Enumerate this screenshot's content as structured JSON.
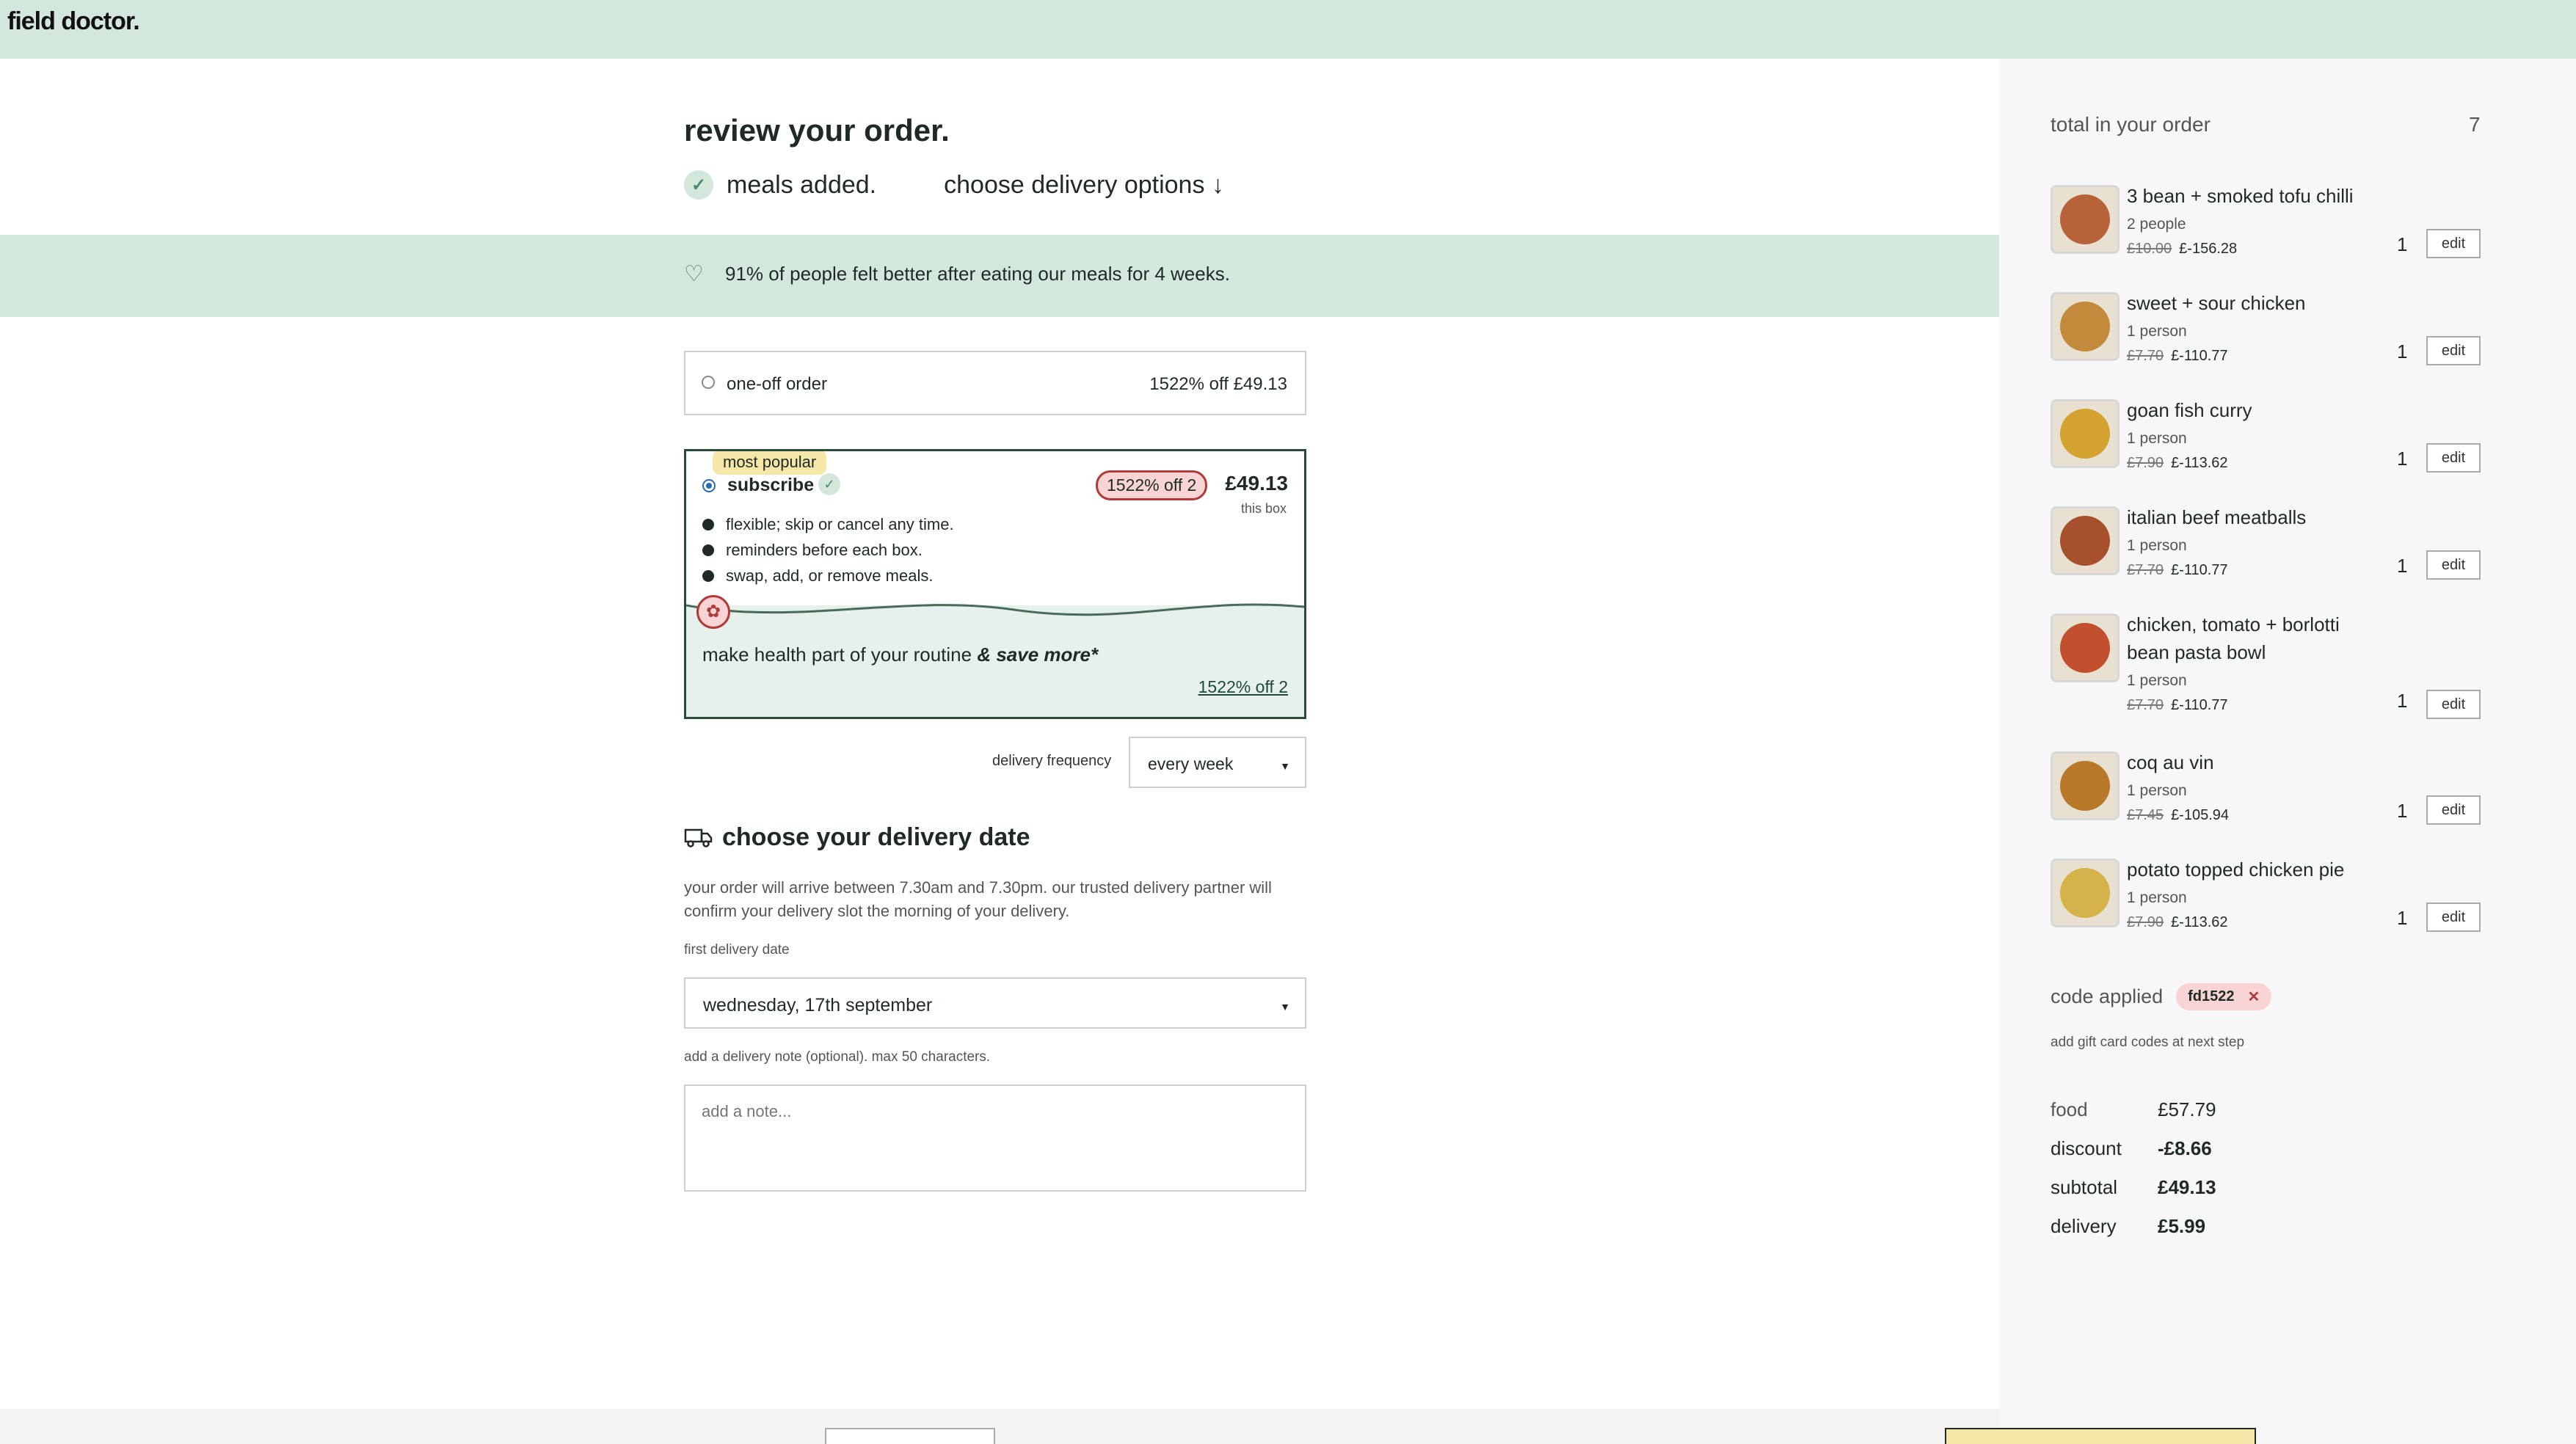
{
  "header": {
    "logo": "field doctor."
  },
  "main": {
    "title": "review your order.",
    "steps": [
      {
        "label": "meals added."
      },
      {
        "label": "choose delivery options ↓"
      }
    ],
    "promo": "91% of people felt better after eating our meals for 4 weeks.",
    "oneoff": {
      "label": "one-off order",
      "price": "1522% off  £49.13"
    },
    "subscribe": {
      "tag": "most popular",
      "label": "subscribe",
      "badge": "1522% off 2",
      "price": "£49.13",
      "note": "this box",
      "bullets": [
        "flexible; skip or cancel any time.",
        "reminders before each box.",
        "swap, add, or remove meals."
      ],
      "routine": "make health part of your routine ",
      "routine_em": "& save more*",
      "link": "1522% off 2"
    },
    "frequency": {
      "label": "delivery frequency",
      "value": "every week"
    },
    "delivery": {
      "title": "choose your delivery date",
      "desc": "your order will arrive between 7.30am and 7.30pm. our trusted delivery partner will confirm your delivery slot the morning of your delivery.",
      "first_date_label": "first delivery date",
      "date_value": "wednesday, 17th september",
      "note_label": "add a delivery note (optional). max 50 characters.",
      "note_placeholder": "add a note..."
    }
  },
  "summary": {
    "title": "total in your order",
    "count": "7",
    "items": [
      {
        "name": "3 bean + smoked tofu chilli",
        "serves": "2 people",
        "old": "£10.00",
        "new": "£-156.28",
        "qty": "1",
        "edit": "edit"
      },
      {
        "name": "sweet + sour chicken",
        "serves": "1 person",
        "old": "£7.70",
        "new": "£-110.77",
        "qty": "1",
        "edit": "edit"
      },
      {
        "name": "goan fish curry",
        "serves": "1 person",
        "old": "£7.90",
        "new": "£-113.62",
        "qty": "1",
        "edit": "edit"
      },
      {
        "name": "italian beef meatballs",
        "serves": "1 person",
        "old": "£7.70",
        "new": "£-110.77",
        "qty": "1",
        "edit": "edit"
      },
      {
        "name": "chicken, tomato + borlotti bean pasta bowl",
        "serves": "1 person",
        "old": "£7.70",
        "new": "£-110.77",
        "qty": "1",
        "edit": "edit"
      },
      {
        "name": "coq au vin",
        "serves": "1 person",
        "old": "£7.45",
        "new": "£-105.94",
        "qty": "1",
        "edit": "edit"
      },
      {
        "name": "potato topped chicken pie",
        "serves": "1 person",
        "old": "£7.90",
        "new": "£-113.62",
        "qty": "1",
        "edit": "edit"
      }
    ],
    "code_label": "code applied",
    "code": "fd1522",
    "gift_note": "add gift card codes at next step",
    "totals": [
      {
        "label": "food",
        "value": "£57.79"
      },
      {
        "label": "discount",
        "value": "-£8.66"
      },
      {
        "label": "subtotal",
        "value": "£49.13"
      },
      {
        "label": "delivery",
        "value": "£5.99"
      }
    ]
  },
  "colors": {
    "mint": "#d4e7dc",
    "accent_green": "#4a8a6a",
    "pink": "#f8d4d4",
    "red": "#b03a3a",
    "yellow": "#f5e7a8"
  }
}
